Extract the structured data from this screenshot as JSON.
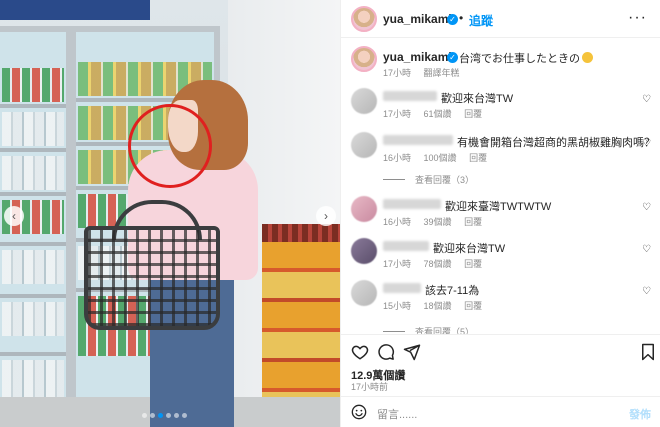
{
  "photo": {
    "banner_text": "",
    "carousel_dots": 6,
    "active_dot": 3,
    "highlight_color": "#e0201f"
  },
  "post_header": {
    "username": "yua_mikami",
    "verified_mark": "✓",
    "separator": "•",
    "follow_label": "追蹤",
    "more_label": "···"
  },
  "caption": {
    "username": "yua_mikami",
    "text": "台湾でお仕事したときの",
    "time": "17小時",
    "translate": "翻譯年糕"
  },
  "comments": [
    {
      "text": "歡迎來台灣TW",
      "time": "17小時",
      "likes": "61個讚",
      "reply": "回覆",
      "avatar": "gray"
    },
    {
      "text": "有機會開箱台灣超商的黑胡椒雞胸肉嗎？",
      "time": "16小時",
      "likes": "100個讚",
      "reply": "回覆",
      "avatar": "gray"
    },
    {
      "text": "歡迎來臺灣TWTWTW",
      "time": "16小時",
      "likes": "39個讚",
      "reply": "回覆",
      "avatar": "pink"
    },
    {
      "text": "歡迎來台灣TW",
      "time": "17小時",
      "likes": "78個讚",
      "reply": "回覆",
      "avatar": "dark"
    },
    {
      "text": "該去7-11為",
      "time": "15小時",
      "likes": "18個讚",
      "reply": "回覆",
      "avatar": "gray"
    }
  ],
  "view_replies_1": "查看回覆（3）",
  "view_replies_2": "查看回覆（5）",
  "likes_count": "12.9萬個讚",
  "post_time": "17小時前",
  "composer": {
    "placeholder": "留言......",
    "post_label": "發佈"
  },
  "colors": {
    "accent": "#0095f6",
    "muted": "#8e8e8e",
    "post_disabled": "#b2dffc"
  },
  "icons": {
    "like": "heart-icon",
    "comment": "comment-icon",
    "share": "send-icon",
    "save": "bookmark-icon",
    "emoji": "smile-icon",
    "more": "more-icon"
  }
}
